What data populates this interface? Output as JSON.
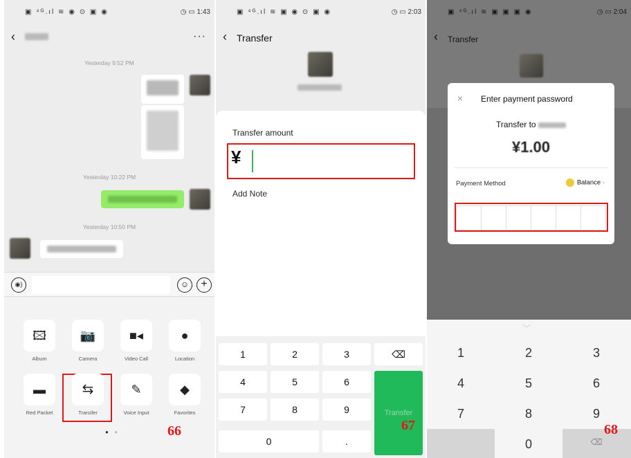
{
  "panel1": {
    "status_left": "▣ ⁴ᴳ.ıl ≋ ◉ ⊙ ▣ ◉",
    "status_right": "◷ ▭ 1:43",
    "back": "‹",
    "more": "···",
    "timestamps": [
      "Yesterday 9:52 PM",
      "Yesterday 10:22 PM",
      "Yesterday 10:50 PM"
    ],
    "voice_icon": "voice-icon",
    "emoji_icon": "emoji-icon",
    "plus_icon": "plus-icon",
    "tiles": [
      {
        "label": "Album",
        "icon": "image-icon",
        "glyph": "🖾"
      },
      {
        "label": "Camera",
        "icon": "camera-icon",
        "glyph": "📷"
      },
      {
        "label": "Video Call",
        "icon": "video-icon",
        "glyph": "■◂"
      },
      {
        "label": "Location",
        "icon": "location-icon",
        "glyph": "●"
      },
      {
        "label": "Red Packet",
        "icon": "red-packet-icon",
        "glyph": "▬"
      },
      {
        "label": "Transfer",
        "icon": "transfer-icon",
        "glyph": "⇆"
      },
      {
        "label": "Voice Input",
        "icon": "mic-icon",
        "glyph": "✎"
      },
      {
        "label": "Favorites",
        "icon": "cube-icon",
        "glyph": "◆"
      }
    ],
    "step": "66"
  },
  "panel2": {
    "status_left": "▣ ⁴ᴳ.ıl ≋ ▣ ◉ ⊙ ▣ ◉",
    "status_right": "◷ ▭ 2:03",
    "back": "‹",
    "title": "Transfer",
    "amount_label": "Transfer amount",
    "currency": "¥",
    "add_note": "Add Note",
    "keys": [
      "1",
      "2",
      "3",
      "4",
      "5",
      "6",
      "7",
      "8",
      "9",
      "0",
      "."
    ],
    "backspace_icon": "backspace-icon",
    "transfer_button": "Transfer",
    "step": "67"
  },
  "panel3": {
    "status_left": "▣ ⁴ᴳ.ıl ≋ ▣ ▣ ▣ ◉",
    "status_right": "◷ ▭ 2:04",
    "back": "‹",
    "title": "Transfer",
    "dialog": {
      "close": "×",
      "title": "Enter payment password",
      "transfer_to": "Transfer to",
      "amount": "¥1.00",
      "payment_method_label": "Payment Method",
      "balance": "Balance",
      "chevron": "›"
    },
    "keys": [
      "1",
      "2",
      "3",
      "4",
      "5",
      "6",
      "7",
      "8",
      "9",
      "0"
    ],
    "delete_icon": "delete-icon",
    "step": "68"
  }
}
